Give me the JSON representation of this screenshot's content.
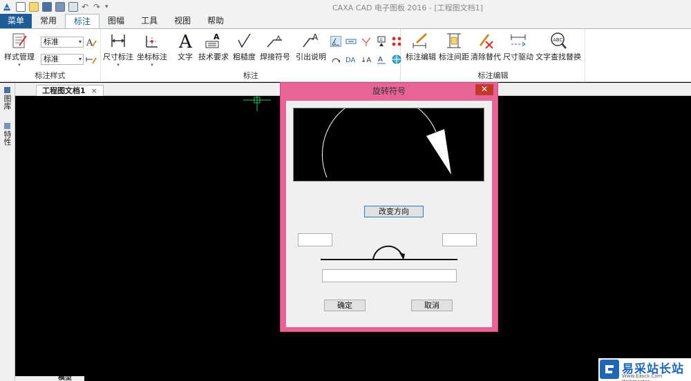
{
  "window": {
    "title": "CAXA CAD 电子图板 2016 - [工程图文档1]"
  },
  "tabs": [
    {
      "label": "菜单"
    },
    {
      "label": "常用"
    },
    {
      "label": "标注"
    },
    {
      "label": "图幅"
    },
    {
      "label": "工具"
    },
    {
      "label": "视图"
    },
    {
      "label": "帮助"
    }
  ],
  "active_tab": "标注",
  "ribbon": {
    "style_group": {
      "label": "标注样式",
      "style_manager": "样式管理",
      "combo1": "标准",
      "combo2": "标准"
    },
    "annotate_group": {
      "label": "标注",
      "buttons": [
        {
          "label": "尺寸标注",
          "icon": "dimension-icon"
        },
        {
          "label": "坐标标注",
          "icon": "coordinate-dimension-icon"
        },
        {
          "label": "文字",
          "icon": "text-icon"
        },
        {
          "label": "技术要求",
          "icon": "tech-requirement-icon"
        },
        {
          "label": "粗糙度",
          "icon": "roughness-icon"
        },
        {
          "label": "焊接符号",
          "icon": "weld-symbol-icon"
        },
        {
          "label": "引出说明",
          "icon": "leader-note-icon"
        }
      ]
    },
    "edit_group": {
      "label": "标注编辑",
      "buttons": [
        {
          "label": "标注编辑",
          "icon": "dimension-edit-icon"
        },
        {
          "label": "标注间距",
          "icon": "dimension-spacing-icon"
        },
        {
          "label": "清除替代",
          "icon": "clear-override-icon"
        },
        {
          "label": "尺寸驱动",
          "icon": "dimension-drive-icon"
        },
        {
          "label": "文字查找替换",
          "icon": "find-replace-text-icon"
        }
      ]
    }
  },
  "left_panel": {
    "tab1": "图库",
    "tab2": "特性"
  },
  "document_tab": {
    "label": "工程图文档1",
    "close": "×"
  },
  "model_tab": {
    "label": "模型"
  },
  "dialog": {
    "title": "旋转符号",
    "close": "✕",
    "change_direction": "改变方向",
    "left_field": "",
    "right_field": "",
    "bottom_field": "",
    "ok": "确定",
    "cancel": "取消"
  },
  "watermark": {
    "name": "易采站长站",
    "url": "Www.Easck.Com Webmaster"
  },
  "colors": {
    "menu_tab": "#1e5c97",
    "dialog_frame": "#e86497",
    "close_button": "#c0392b",
    "canvas": "#000000"
  }
}
